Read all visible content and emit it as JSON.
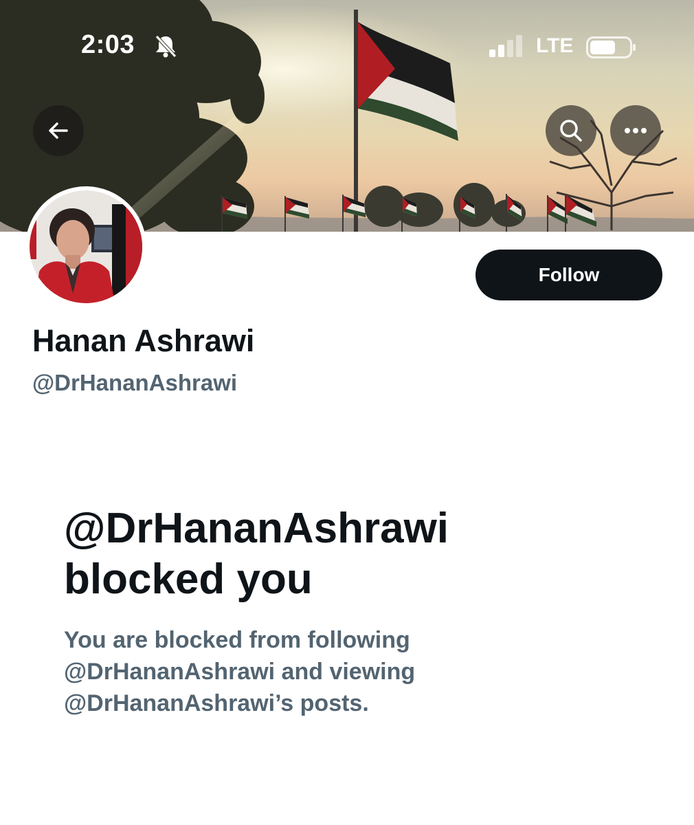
{
  "status_bar": {
    "time": "2:03",
    "network": "LTE",
    "icons": [
      "bell-slash-icon",
      "cellular-signal-icon",
      "battery-icon"
    ]
  },
  "header": {
    "icons": [
      "back-arrow-icon",
      "search-icon",
      "more-icon"
    ]
  },
  "profile": {
    "display_name": "Hanan Ashrawi",
    "handle": "@DrHananAshrawi",
    "follow_label": "Follow"
  },
  "blocked": {
    "title_line1": "@DrHananAshrawi",
    "title_line2": "blocked you",
    "desc_line1": "You are blocked from following",
    "desc_line2": "@DrHananAshrawi and viewing",
    "desc_line3": "@DrHananAshrawi’s posts."
  },
  "colors": {
    "text_primary": "#0f1419",
    "text_secondary": "#536471",
    "button_bg": "#0f1419",
    "button_text": "#ffffff",
    "flag_black": "#1c1c1c",
    "flag_white": "#e8e4dc",
    "flag_green": "#2f4a2e",
    "flag_red": "#b01e23"
  }
}
